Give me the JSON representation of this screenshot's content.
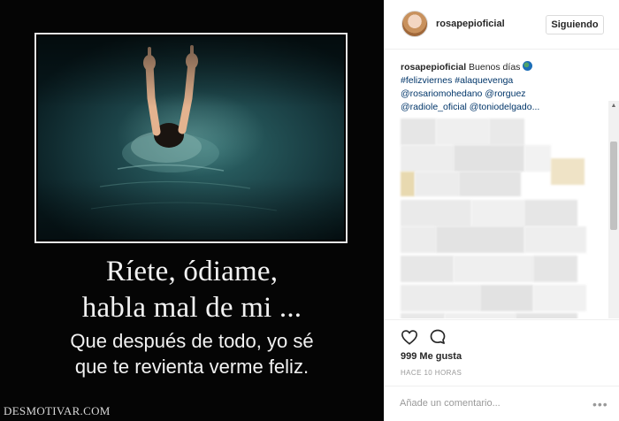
{
  "post": {
    "caption_lines": [
      "Ríete, ódiame,",
      "habla mal de mi ...",
      "Que después de todo, yo sé",
      "que te revienta verme feliz."
    ],
    "watermark": "DESMOTIVAR.COM"
  },
  "header": {
    "username": "rosapepioficial",
    "follow_label": "Siguiendo"
  },
  "comment": {
    "author": "rosapepioficial",
    "text": "Buenos días",
    "hashtags": "#felizviernes #alaquevenga",
    "mentions_line1": "@rosariomohedano @rorguez",
    "mentions_line2": "@radiole_oficial @toniodelgado..."
  },
  "actions": {
    "likes": "999 Me gusta",
    "time": "HACE 10 HORAS",
    "like_icon": "heart-icon",
    "comment_icon": "comment-icon"
  },
  "add_comment": {
    "placeholder": "Añade un comentario...",
    "more_icon": "ellipsis-icon"
  }
}
